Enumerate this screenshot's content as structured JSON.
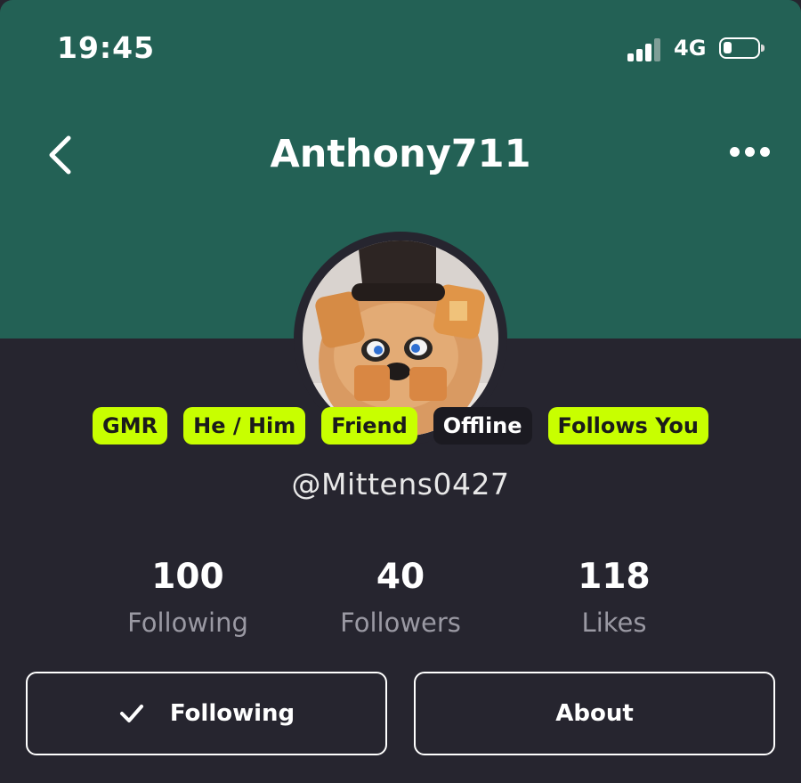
{
  "status_bar": {
    "time": "19:45",
    "network": "4G",
    "signal_icon": "signal-bars-icon",
    "battery_icon": "battery-low-icon"
  },
  "header": {
    "title": "Anthony711",
    "back_icon": "chevron-left-icon",
    "more_icon": "more-horizontal-icon",
    "background": "#236155"
  },
  "profile": {
    "avatar": "profile-avatar-image",
    "tags": [
      {
        "label": "GMR",
        "color": "#c8ff00"
      },
      {
        "label": "He / Him",
        "color": "#c8ff00"
      },
      {
        "label": "Friend",
        "color": "#c8ff00"
      },
      {
        "label": "Offline",
        "color": "#1b1a21"
      },
      {
        "label": "Follows You",
        "color": "#c8ff00"
      }
    ],
    "handle": "@Mittens0427"
  },
  "stats": [
    {
      "value": "100",
      "label": "Following"
    },
    {
      "value": "40",
      "label": "Followers"
    },
    {
      "value": "118",
      "label": "Likes"
    }
  ],
  "actions": {
    "following_label": "Following",
    "following_icon": "checkmark-icon",
    "about_label": "About"
  }
}
